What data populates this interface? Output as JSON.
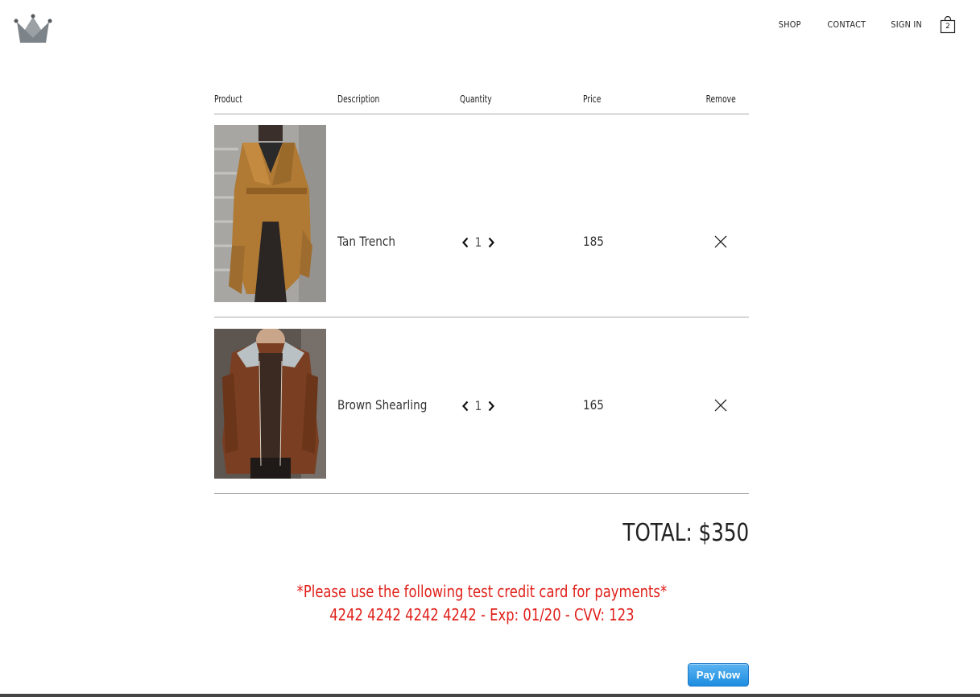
{
  "header": {
    "logo_icon": "crown-icon",
    "nav": {
      "shop": "SHOP",
      "contact": "CONTACT",
      "sign_in": "SIGN IN"
    },
    "cart": {
      "icon": "shopping-bag-icon",
      "count": "2"
    }
  },
  "table": {
    "headers": {
      "product": "Product",
      "description": "Description",
      "quantity": "Quantity",
      "price": "Price",
      "remove": "Remove"
    },
    "items": [
      {
        "image_icon": "tan-trench-coat-photo",
        "description": "Tan Trench",
        "quantity": "1",
        "price": "185"
      },
      {
        "image_icon": "brown-shearling-jacket-photo",
        "description": "Brown Shearling",
        "quantity": "1",
        "price": "165"
      }
    ]
  },
  "summary": {
    "total": "TOTAL: $350"
  },
  "payment_notice": {
    "line1": "*Please use the following test credit card for payments*",
    "line2": "4242 4242 4242 4242 - Exp: 01/20 - CVV: 123"
  },
  "pay_button": {
    "label": "Pay Now"
  },
  "colors": {
    "notice": "#e0201a",
    "pay_button": "#1d8de0",
    "divider": "#aaaaaa"
  }
}
